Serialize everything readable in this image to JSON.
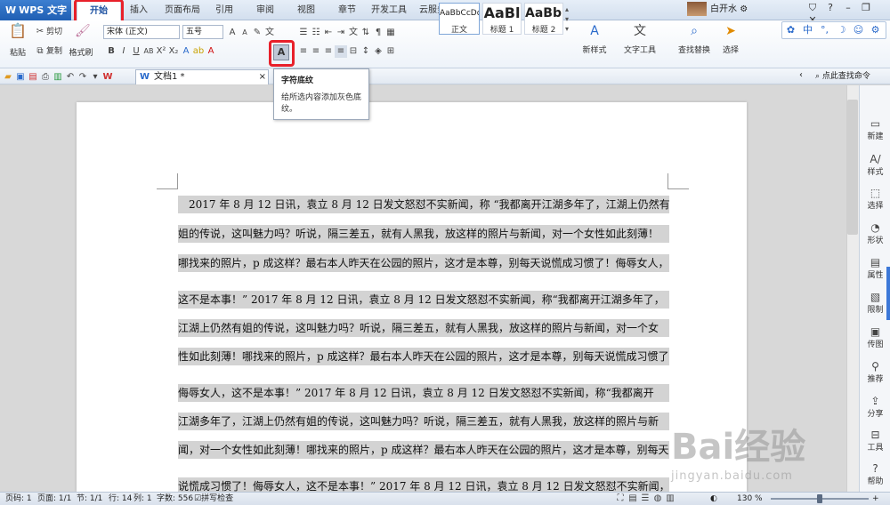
{
  "titlebar": {
    "app_name": "WPS 文字",
    "tabs": [
      "开始",
      "插入",
      "页面布局",
      "引用",
      "审阅",
      "视图",
      "章节",
      "开发工具",
      "云服务"
    ],
    "user_name": "白开水"
  },
  "ribbon": {
    "clipboard": {
      "paste": "粘贴",
      "cut": "剪切",
      "copy": "复制",
      "format_painter": "格式刷"
    },
    "font_name": "宋体 (正文)",
    "font_size": "五号",
    "styles": [
      {
        "sample": "AaBbCcDd",
        "name": "正文"
      },
      {
        "sample": "AaBl",
        "name": "标题 1"
      },
      {
        "sample": "AaBb(",
        "name": "标题 2"
      }
    ],
    "new_style": "新样式",
    "text_tools": "文字工具",
    "find_replace": "查找替换",
    "select": "选择"
  },
  "pawbar": [
    "中",
    "°,",
    "☽",
    "☺"
  ],
  "quick": {
    "doc_tab": "文档1 *",
    "find_command": "点此查找命令"
  },
  "tooltip": {
    "title": "字符底纹",
    "desc_line1": "给所选内容添加灰色底",
    "desc_line2": "纹。"
  },
  "document": {
    "lines": [
      "2017 年 8 月 12 日讯，袁立 8 月 12 日发文怒怼不实新闻，称 “我都离开江湖多年了，江湖上仍然有",
      "姐的传说，这叫魅力吗？听说，隔三差五，就有人黑我，放这样的照片与新闻，对一个女性如此刻薄！",
      "哪找来的照片，p 成这样？最右本人昨天在公园的照片，这才是本尊，别每天说慌成习惯了！侮辱女人，",
      "这不是本事！” 2017 年 8 月 12 日讯，袁立 8 月 12 日发文怒怼不实新闻，称“我都离开江湖多年了，",
      "江湖上仍然有姐的传说，这叫魅力吗？听说，隔三差五，就有人黑我，放这样的照片与新闻，对一个女",
      "性如此刻薄！哪找来的照片，p 成这样？最右本人昨天在公园的照片，这才是本尊，别每天说慌成习惯了！",
      "侮辱女人，这不是本事！” 2017 年 8 月 12 日讯，袁立 8 月 12 日发文怒怼不实新闻，称“我都离开",
      "江湖多年了，江湖上仍然有姐的传说，这叫魅力吗？听说，隔三差五，就有人黑我，放这样的照片与新",
      "闻，对一个女性如此刻薄！哪找来的照片，p 成这样？最右本人昨天在公园的照片，这才是本尊，别每天",
      "说慌成习惯了！侮辱女人，这不是本事！” 2017 年 8 月 12 日讯，袁立 8 月 12 日发文怒怼不实新闻，"
    ]
  },
  "right_panel": [
    "新建",
    "样式",
    "选择",
    "形状",
    "属性",
    "限制",
    "传图",
    "推荐",
    "分享",
    "工具",
    "帮助"
  ],
  "status": {
    "page_num": "页码: 1",
    "pages": "页面: 1/1",
    "section": "节: 1/1",
    "row": "行: 14",
    "col": "列: 1",
    "word_count": "字数: 556",
    "spell_check": "拼写检查",
    "zoom": "130 %"
  },
  "watermark": {
    "brand": "Bai经验",
    "url": "jingyan.baidu.com"
  },
  "colors": {
    "highlight_red": "#e8202a",
    "accent_blue": "#1f5fb3",
    "shading_gray": "#d3d3d3"
  }
}
